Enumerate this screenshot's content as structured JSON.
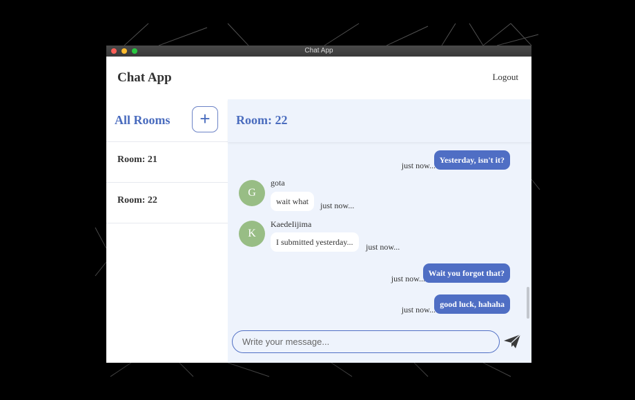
{
  "window": {
    "title": "Chat App"
  },
  "header": {
    "brand": "Chat App",
    "logout_label": "Logout"
  },
  "sidebar": {
    "title": "All Rooms",
    "add_label": "+",
    "rooms": [
      {
        "label": "Room: 21"
      },
      {
        "label": "Room: 22"
      }
    ]
  },
  "chat": {
    "room_title": "Room: 22",
    "messages": [
      {
        "type": "mine",
        "text": "Yesterday, isn't it?",
        "time": "just now..."
      },
      {
        "type": "theirs",
        "user": "gota",
        "initial": "G",
        "text": "wait what",
        "time": "just now..."
      },
      {
        "type": "theirs",
        "user": "KaedeIijima",
        "initial": "K",
        "text": "I submitted yesterday...",
        "time": "just now..."
      },
      {
        "type": "mine",
        "text": "Wait you forgot that?",
        "time": "just now..."
      },
      {
        "type": "mine",
        "text": "good luck, hahaha",
        "time": "just now..."
      }
    ],
    "input_placeholder": "Write your message...",
    "input_value": "",
    "send_icon": "send-icon"
  },
  "colors": {
    "accent": "#4a6cbe",
    "bubble_mine": "#4f6ec4",
    "avatar": "#98bd85",
    "chat_bg": "#eef3fc"
  }
}
